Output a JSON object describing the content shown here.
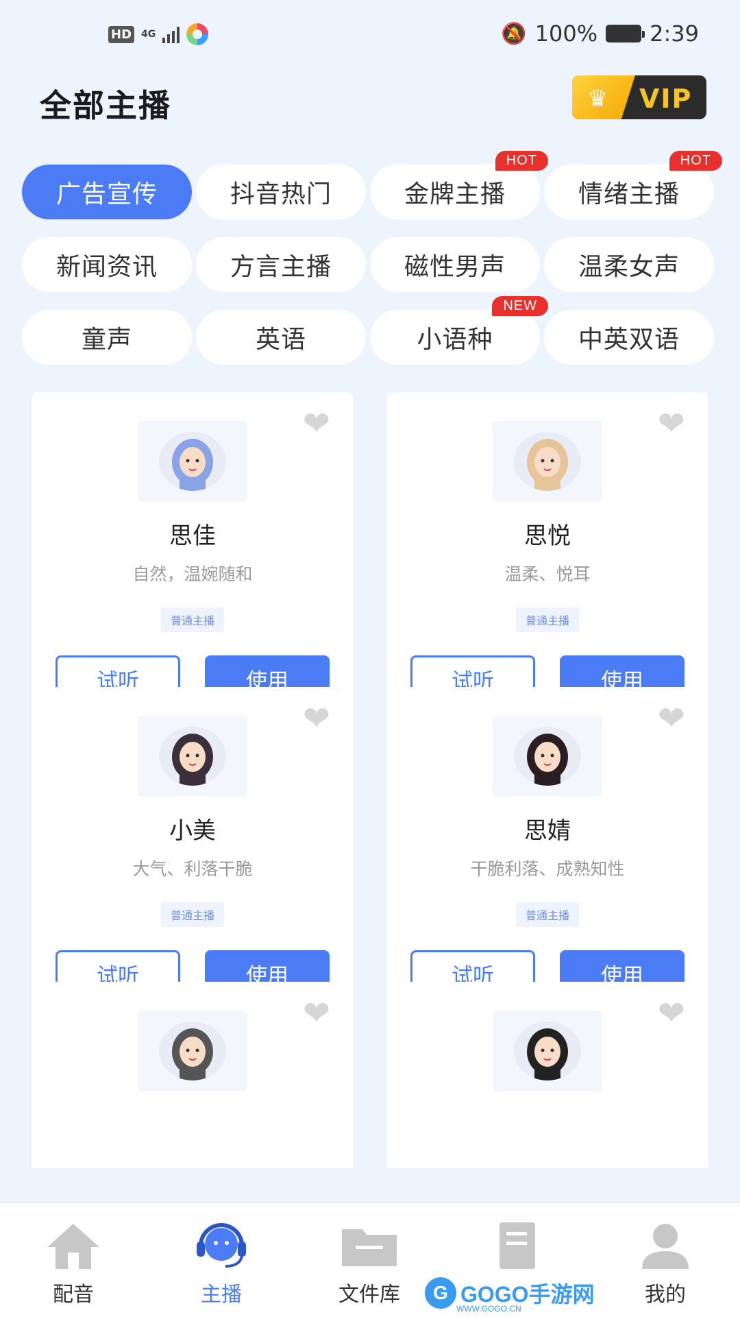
{
  "status_bar": {
    "hd": "HD",
    "network": "4G",
    "battery": "100%",
    "time": "2:39"
  },
  "header": {
    "title": "全部主播",
    "vip_label": "VIP"
  },
  "categories": [
    {
      "label": "广告宣传",
      "active": true,
      "badge": ""
    },
    {
      "label": "抖音热门",
      "active": false,
      "badge": ""
    },
    {
      "label": "金牌主播",
      "active": false,
      "badge": "HOT"
    },
    {
      "label": "情绪主播",
      "active": false,
      "badge": "HOT"
    },
    {
      "label": "新闻资讯",
      "active": false,
      "badge": ""
    },
    {
      "label": "方言主播",
      "active": false,
      "badge": ""
    },
    {
      "label": "磁性男声",
      "active": false,
      "badge": ""
    },
    {
      "label": "温柔女声",
      "active": false,
      "badge": ""
    },
    {
      "label": "童声",
      "active": false,
      "badge": ""
    },
    {
      "label": "英语",
      "active": false,
      "badge": ""
    },
    {
      "label": "小语种",
      "active": false,
      "badge": "NEW"
    },
    {
      "label": "中英双语",
      "active": false,
      "badge": ""
    }
  ],
  "voices": [
    {
      "name": "思佳",
      "desc": "自然，温婉随和",
      "tag": "普通主播",
      "try_label": "试听",
      "use_label": "使用",
      "avatar_color": "#8aa3e6"
    },
    {
      "name": "思悦",
      "desc": "温柔、悦耳",
      "tag": "普通主播",
      "try_label": "试听",
      "use_label": "使用",
      "avatar_color": "#e7c49a"
    },
    {
      "name": "小美",
      "desc": "大气、利落干脆",
      "tag": "普通主播",
      "try_label": "试听",
      "use_label": "使用",
      "avatar_color": "#3a2f3a"
    },
    {
      "name": "思婧",
      "desc": "干脆利落、成熟知性",
      "tag": "普通主播",
      "try_label": "试听",
      "use_label": "使用",
      "avatar_color": "#2b1e22"
    },
    {
      "name": "",
      "desc": "",
      "tag": "",
      "try_label": "",
      "use_label": "",
      "avatar_color": "#555555"
    },
    {
      "name": "",
      "desc": "",
      "tag": "",
      "try_label": "",
      "use_label": "",
      "avatar_color": "#222222"
    }
  ],
  "tabbar": {
    "items": [
      {
        "label": "配音",
        "icon": "home-icon",
        "active": false
      },
      {
        "label": "主播",
        "icon": "headset-icon",
        "active": true
      },
      {
        "label": "文件库",
        "icon": "folder-icon",
        "active": false
      },
      {
        "label": "",
        "icon": "document-icon",
        "active": false
      },
      {
        "label": "我的",
        "icon": "user-icon",
        "active": false
      }
    ]
  },
  "watermark": {
    "brand": "GOGO手游网",
    "url": "WWW.GOGO.CN"
  },
  "colors": {
    "accent": "#4b7bf5",
    "background": "#eef4fd",
    "hot_badge": "#e8302d"
  }
}
